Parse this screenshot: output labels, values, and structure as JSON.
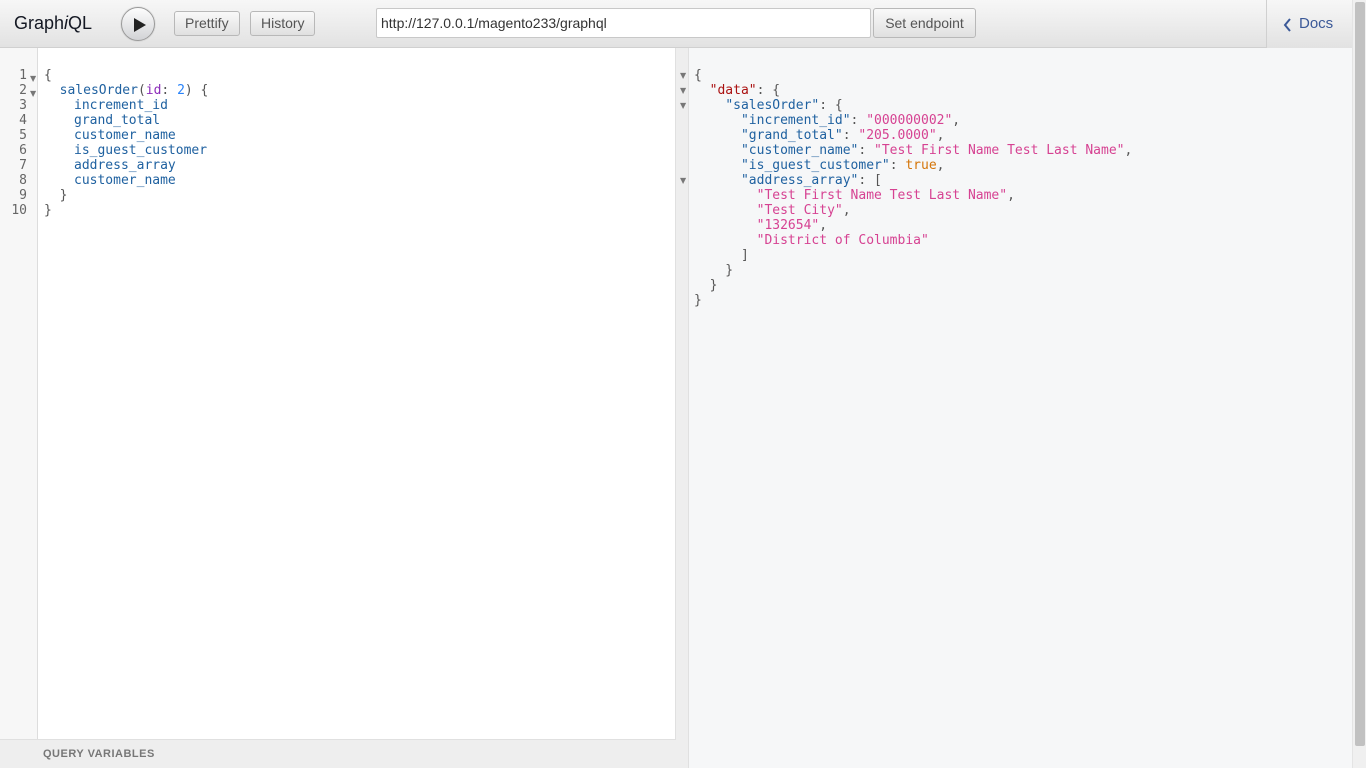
{
  "app": {
    "title_prefix": "Graph",
    "title_italic": "i",
    "title_suffix": "QL"
  },
  "toolbar": {
    "prettify_label": "Prettify",
    "history_label": "History",
    "endpoint_value": "http://127.0.0.1/magento233/graphql",
    "set_endpoint_label": "Set endpoint",
    "docs_label": "Docs"
  },
  "query": {
    "line_numbers": [
      "1",
      "2",
      "3",
      "4",
      "5",
      "6",
      "7",
      "8",
      "9",
      "10"
    ],
    "operation": "salesOrder",
    "arg_name": "id",
    "arg_value": "2",
    "fields": [
      "increment_id",
      "grand_total",
      "customer_name",
      "is_guest_customer",
      "address_array",
      "customer_name"
    ]
  },
  "variables_bar": {
    "label": "QUERY VARIABLES"
  },
  "result": {
    "data_key": "\"data\"",
    "root_key": "\"salesOrder\"",
    "entries": [
      {
        "key": "\"increment_id\"",
        "value": "\"000000002\""
      },
      {
        "key": "\"grand_total\"",
        "value": "\"205.0000\""
      },
      {
        "key": "\"customer_name\"",
        "value": "\"Test First Name Test Last Name\""
      },
      {
        "key": "\"is_guest_customer\"",
        "value": "true"
      }
    ],
    "array_key": "\"address_array\"",
    "array_values": [
      "\"Test First Name Test Last Name\"",
      "\"Test City\"",
      "\"132654\"",
      "\"District of Columbia\""
    ]
  },
  "colors": {
    "field": "#1f61a0",
    "string": "#d64292",
    "boolean": "#d47509",
    "top_key": "#a11",
    "link": "#3b5998"
  },
  "icons": [
    "play-icon",
    "chevron-left-icon",
    "fold-arrow-icon"
  ]
}
